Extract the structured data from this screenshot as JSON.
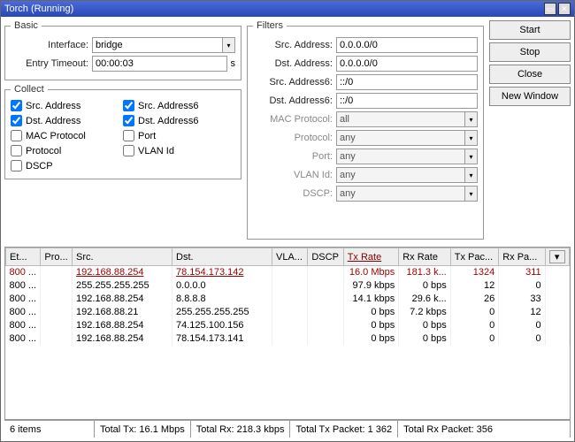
{
  "window": {
    "title": "Torch (Running)"
  },
  "buttons": {
    "start": "Start",
    "stop": "Stop",
    "close": "Close",
    "newwin": "New Window"
  },
  "basic": {
    "legend": "Basic",
    "interface_lbl": "Interface:",
    "interface": "bridge",
    "timeout_lbl": "Entry Timeout:",
    "timeout": "00:00:03",
    "timeout_unit": "s"
  },
  "collect": {
    "legend": "Collect",
    "items": [
      {
        "label": "Src. Address",
        "checked": true
      },
      {
        "label": "Src. Address6",
        "checked": true
      },
      {
        "label": "Dst. Address",
        "checked": true
      },
      {
        "label": "Dst. Address6",
        "checked": true
      },
      {
        "label": "MAC Protocol",
        "checked": false
      },
      {
        "label": "Port",
        "checked": false
      },
      {
        "label": "Protocol",
        "checked": false
      },
      {
        "label": "VLAN Id",
        "checked": false
      },
      {
        "label": "DSCP",
        "checked": false
      }
    ]
  },
  "filters": {
    "legend": "Filters",
    "rows": [
      {
        "label": "Src. Address:",
        "value": "0.0.0.0/0",
        "disabled": false
      },
      {
        "label": "Dst. Address:",
        "value": "0.0.0.0/0",
        "disabled": false
      },
      {
        "label": "Src. Address6:",
        "value": "::/0",
        "disabled": false
      },
      {
        "label": "Dst. Address6:",
        "value": "::/0",
        "disabled": false
      },
      {
        "label": "MAC Protocol:",
        "value": "all",
        "disabled": true
      },
      {
        "label": "Protocol:",
        "value": "any",
        "disabled": true
      },
      {
        "label": "Port:",
        "value": "any",
        "disabled": true
      },
      {
        "label": "VLAN Id:",
        "value": "any",
        "disabled": true
      },
      {
        "label": "DSCP:",
        "value": "any",
        "disabled": true
      }
    ]
  },
  "table": {
    "headers": [
      "Et...",
      "Pro...",
      "Src.",
      "Dst.",
      "VLA...",
      "DSCP",
      "Tx Rate",
      "Rx Rate",
      "Tx Pac...",
      "Rx Pa..."
    ],
    "sort_col": 6,
    "rows": [
      {
        "et": "800 ...",
        "pro": "",
        "src": "192.168.88.254",
        "dst": "78.154.173.142",
        "vla": "",
        "dscp": "",
        "tx": "16.0 Mbps",
        "rx": "181.3 k...",
        "txp": "1324",
        "rxp": "311"
      },
      {
        "et": "800 ...",
        "pro": "",
        "src": "255.255.255.255",
        "dst": "0.0.0.0",
        "vla": "",
        "dscp": "",
        "tx": "97.9 kbps",
        "rx": "0 bps",
        "txp": "12",
        "rxp": "0"
      },
      {
        "et": "800 ...",
        "pro": "",
        "src": "192.168.88.254",
        "dst": "8.8.8.8",
        "vla": "",
        "dscp": "",
        "tx": "14.1 kbps",
        "rx": "29.6 k...",
        "txp": "26",
        "rxp": "33"
      },
      {
        "et": "800 ...",
        "pro": "",
        "src": "192.168.88.21",
        "dst": "255.255.255.255",
        "vla": "",
        "dscp": "",
        "tx": "0 bps",
        "rx": "7.2 kbps",
        "txp": "0",
        "rxp": "12"
      },
      {
        "et": "800 ...",
        "pro": "",
        "src": "192.168.88.254",
        "dst": "74.125.100.156",
        "vla": "",
        "dscp": "",
        "tx": "0 bps",
        "rx": "0 bps",
        "txp": "0",
        "rxp": "0"
      },
      {
        "et": "800 ...",
        "pro": "",
        "src": "192.168.88.254",
        "dst": "78.154.173.141",
        "vla": "",
        "dscp": "",
        "tx": "0 bps",
        "rx": "0 bps",
        "txp": "0",
        "rxp": "0"
      }
    ]
  },
  "status": {
    "items": "6 items",
    "totaltx": "Total Tx: 16.1 Mbps",
    "totalrx": "Total Rx: 218.3 kbps",
    "totaltxp": "Total Tx Packet: 1 362",
    "totalrxp": "Total Rx Packet: 356"
  }
}
